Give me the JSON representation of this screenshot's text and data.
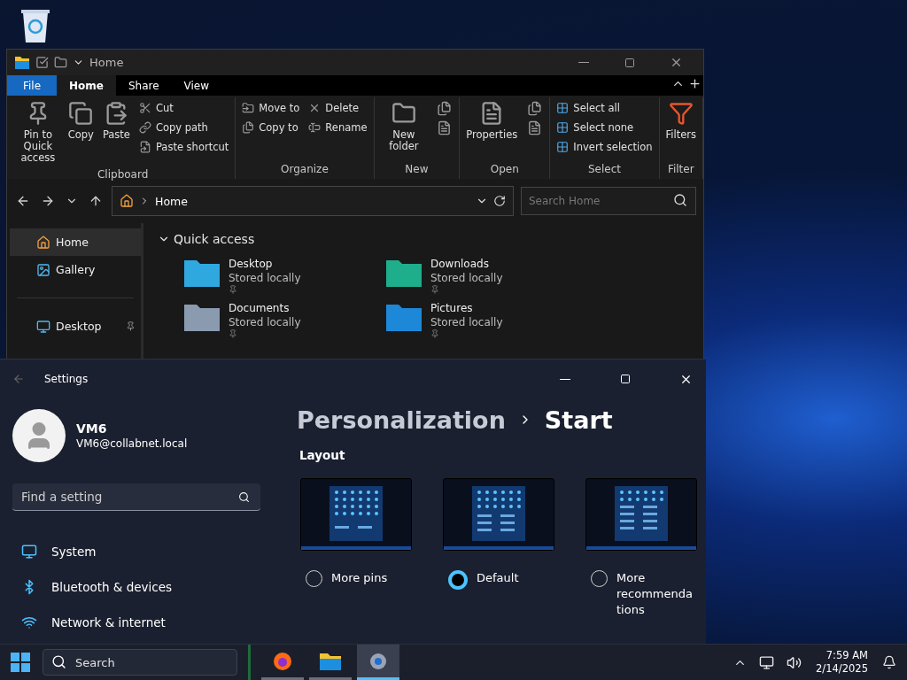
{
  "explorer": {
    "title": "Home",
    "ribbon_tabs": [
      {
        "label": "File",
        "kind": "file",
        "selected": false
      },
      {
        "label": "Home",
        "kind": "tab",
        "selected": true
      },
      {
        "label": "Share",
        "kind": "tab",
        "selected": false
      },
      {
        "label": "View",
        "kind": "tab",
        "selected": false
      }
    ],
    "ribbon_groups": [
      {
        "label": "Clipboard",
        "columns": [
          {
            "kind": "large",
            "items": [
              {
                "label": "Pin to Quick access"
              }
            ]
          },
          {
            "kind": "large",
            "items": [
              {
                "label": "Copy"
              }
            ]
          },
          {
            "kind": "large",
            "items": [
              {
                "label": "Paste"
              }
            ]
          },
          {
            "kind": "small",
            "items": [
              {
                "label": "Cut"
              },
              {
                "label": "Copy path"
              },
              {
                "label": "Paste shortcut"
              }
            ]
          }
        ]
      },
      {
        "label": "Organize",
        "columns": [
          {
            "kind": "small",
            "items": [
              {
                "label": "Move to"
              },
              {
                "label": "Copy to"
              }
            ]
          },
          {
            "kind": "small",
            "items": [
              {
                "label": "Delete"
              },
              {
                "label": "Rename"
              }
            ]
          }
        ]
      },
      {
        "label": "New",
        "columns": [
          {
            "kind": "large",
            "items": [
              {
                "label": "New folder"
              }
            ]
          },
          {
            "kind": "icons"
          }
        ]
      },
      {
        "label": "Open",
        "columns": [
          {
            "kind": "large",
            "items": [
              {
                "label": "Properties"
              }
            ]
          },
          {
            "kind": "icons"
          }
        ]
      },
      {
        "label": "Select",
        "columns": [
          {
            "kind": "small",
            "items": [
              {
                "label": "Select all"
              },
              {
                "label": "Select none"
              },
              {
                "label": "Invert selection"
              }
            ]
          }
        ]
      },
      {
        "label": "Filter",
        "columns": [
          {
            "kind": "large",
            "items": [
              {
                "label": "Filters"
              }
            ]
          }
        ]
      }
    ],
    "address": "Home",
    "search_placeholder": "Search Home",
    "nav_items": [
      {
        "label": "Home",
        "selected": true,
        "pinned": false
      },
      {
        "label": "Gallery",
        "selected": false,
        "pinned": false
      },
      {
        "label": "Desktop",
        "selected": false,
        "pinned": true
      }
    ],
    "section": {
      "label": "Quick access",
      "expanded": true
    },
    "folders": [
      {
        "name": "Desktop",
        "status": "Stored locally",
        "color": "#2fa8e0"
      },
      {
        "name": "Downloads",
        "status": "Stored locally",
        "color": "#1fae8c"
      },
      {
        "name": "Documents",
        "status": "Stored locally",
        "color": "#8a9bb0"
      },
      {
        "name": "Pictures",
        "status": "Stored locally",
        "color": "#1e88d8"
      }
    ]
  },
  "settings": {
    "title": "Settings",
    "user": {
      "name": "VM6",
      "email": "VM6@collabnet.local"
    },
    "search_placeholder": "Find a setting",
    "nav_items": [
      {
        "label": "System",
        "selected": false
      },
      {
        "label": "Bluetooth & devices",
        "selected": false
      },
      {
        "label": "Network & internet",
        "selected": false
      }
    ],
    "breadcrumb": [
      "Personalization",
      "Start"
    ],
    "section": "Layout",
    "layout_options": [
      {
        "label": "More pins",
        "kind": "pins",
        "selected": false
      },
      {
        "label": "Default",
        "kind": "default",
        "selected": true
      },
      {
        "label": "More recommendations",
        "kind": "recs",
        "selected": false
      }
    ]
  },
  "taskbar": {
    "search_placeholder": "Search",
    "apps": [
      {
        "kind": "browser",
        "selected": false
      },
      {
        "kind": "folder",
        "selected": false
      },
      {
        "kind": "settings",
        "selected": true
      }
    ],
    "time": "7:59 AM",
    "date": "2/14/2025"
  }
}
